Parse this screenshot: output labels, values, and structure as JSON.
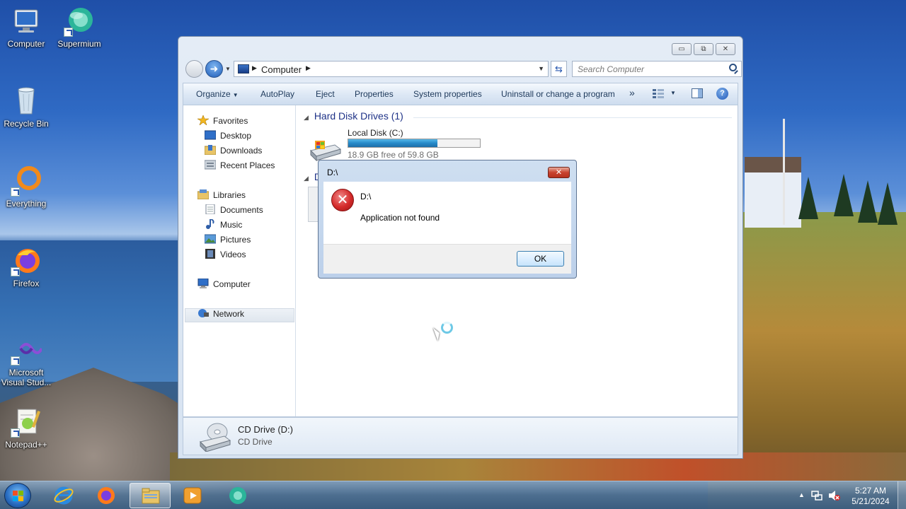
{
  "desktop": {
    "icons": [
      {
        "label": "Computer"
      },
      {
        "label": "Supermium"
      },
      {
        "label": "Recycle Bin"
      },
      {
        "label": "Everything"
      },
      {
        "label": "Firefox"
      },
      {
        "label": "Microsoft Visual Stud..."
      },
      {
        "label": "Notepad++"
      }
    ]
  },
  "window": {
    "controls": {
      "minimize": "▭",
      "restore": "⧉",
      "close": "✕"
    },
    "address": {
      "crumb": "Computer"
    },
    "search": {
      "placeholder": "Search Computer"
    },
    "toolbar": {
      "organize": "Organize",
      "autoplay": "AutoPlay",
      "eject": "Eject",
      "properties": "Properties",
      "system_properties": "System properties",
      "uninstall": "Uninstall or change a program",
      "more": "»",
      "help": "?"
    },
    "navpane": {
      "favorites": "Favorites",
      "desktop": "Desktop",
      "downloads": "Downloads",
      "recent": "Recent Places",
      "libraries": "Libraries",
      "documents": "Documents",
      "music": "Music",
      "pictures": "Pictures",
      "videos": "Videos",
      "computer": "Computer",
      "network": "Network"
    },
    "main": {
      "group_hdd": "Hard Disk Drives (1)",
      "group_removable_initial": "D",
      "drive_c": {
        "name": "Local Disk (C:)",
        "free_text": "18.9 GB free of 59.8 GB",
        "used_fraction": 0.68
      }
    },
    "details": {
      "name": "CD Drive (D:)",
      "type": "CD Drive"
    }
  },
  "dialog": {
    "title": "D:\\",
    "close": "✕",
    "heading": "D:\\",
    "message": "Application not found",
    "ok": "OK"
  },
  "taskbar": {
    "apps": [
      {
        "icon": "internet-explorer-icon"
      },
      {
        "icon": "firefox-icon"
      },
      {
        "icon": "explorer-icon",
        "active": true
      },
      {
        "icon": "media-player-icon"
      },
      {
        "icon": "supermium-icon"
      }
    ],
    "tray_up": "▲",
    "time": "5:27 AM",
    "date": "5/21/2024"
  },
  "colors": {
    "accent": "#1e3287",
    "drive_fill": "#268ac9",
    "error_red": "#d42a2a"
  }
}
